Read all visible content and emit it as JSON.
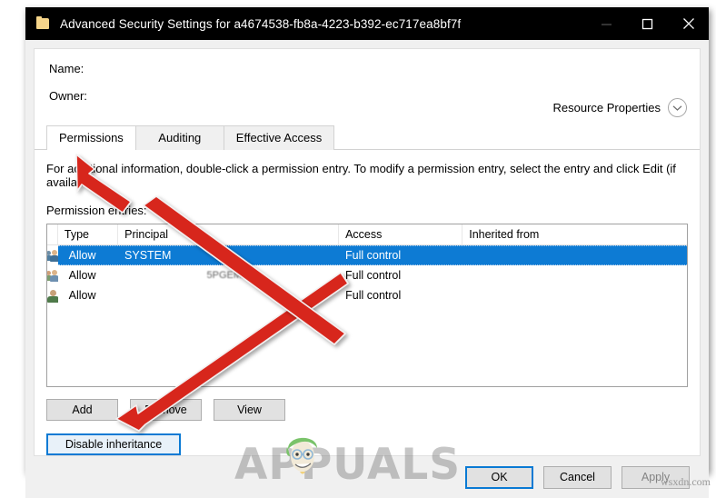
{
  "window": {
    "title": "Advanced Security Settings for a4674538-fb8a-4223-b392-ec717ea8bf7f",
    "icon": "folder-icon",
    "minimize_label": "Minimize",
    "maximize_label": "Maximize",
    "close_label": "Close"
  },
  "header": {
    "name_label": "Name:",
    "name_value": "",
    "owner_label": "Owner:",
    "owner_value": "",
    "resource_properties_label": "Resource Properties",
    "resource_properties_icon": "chevron-down-circle-icon"
  },
  "tabs": [
    {
      "label": "Permissions",
      "active": true
    },
    {
      "label": "Auditing",
      "active": false
    },
    {
      "label": "Effective Access",
      "active": false
    }
  ],
  "permissions": {
    "info_text": "For additional information, double-click a permission entry. To modify a permission entry, select the entry and click Edit (if available).",
    "entries_label": "Permission entries:",
    "columns": [
      "Type",
      "Principal",
      "Access",
      "Inherited from"
    ],
    "rows": [
      {
        "icon": "group-icon",
        "type": "Allow",
        "principal": "SYSTEM",
        "access": "Full control",
        "inherited_from": "",
        "selected": true
      },
      {
        "icon": "group-icon",
        "type": "Allow",
        "principal": "5PGEM2W",
        "access": "Full control",
        "inherited_from": "",
        "selected": false
      },
      {
        "icon": "user-icon",
        "type": "Allow",
        "principal": "",
        "access": "Full control",
        "inherited_from": "",
        "selected": false
      }
    ],
    "buttons": {
      "add": "Add",
      "remove": "Remove",
      "view": "View",
      "disable_inheritance": "Disable inheritance"
    }
  },
  "footer": {
    "ok": "OK",
    "cancel": "Cancel",
    "apply": "Apply",
    "apply_disabled": true
  },
  "watermarks": {
    "brand": "APPUALS",
    "site": "wsxdn.com"
  },
  "annotations": {
    "arrow_color": "#d7261f",
    "arrow_1_target": "permissions-tab",
    "arrow_2_target": "disable-inheritance-button"
  },
  "colors": {
    "selection_blue": "#0d7bd4",
    "focus_blue": "#0a7ad4",
    "titlebar": "#000000",
    "dialog_bg": "#f0f0f0"
  }
}
